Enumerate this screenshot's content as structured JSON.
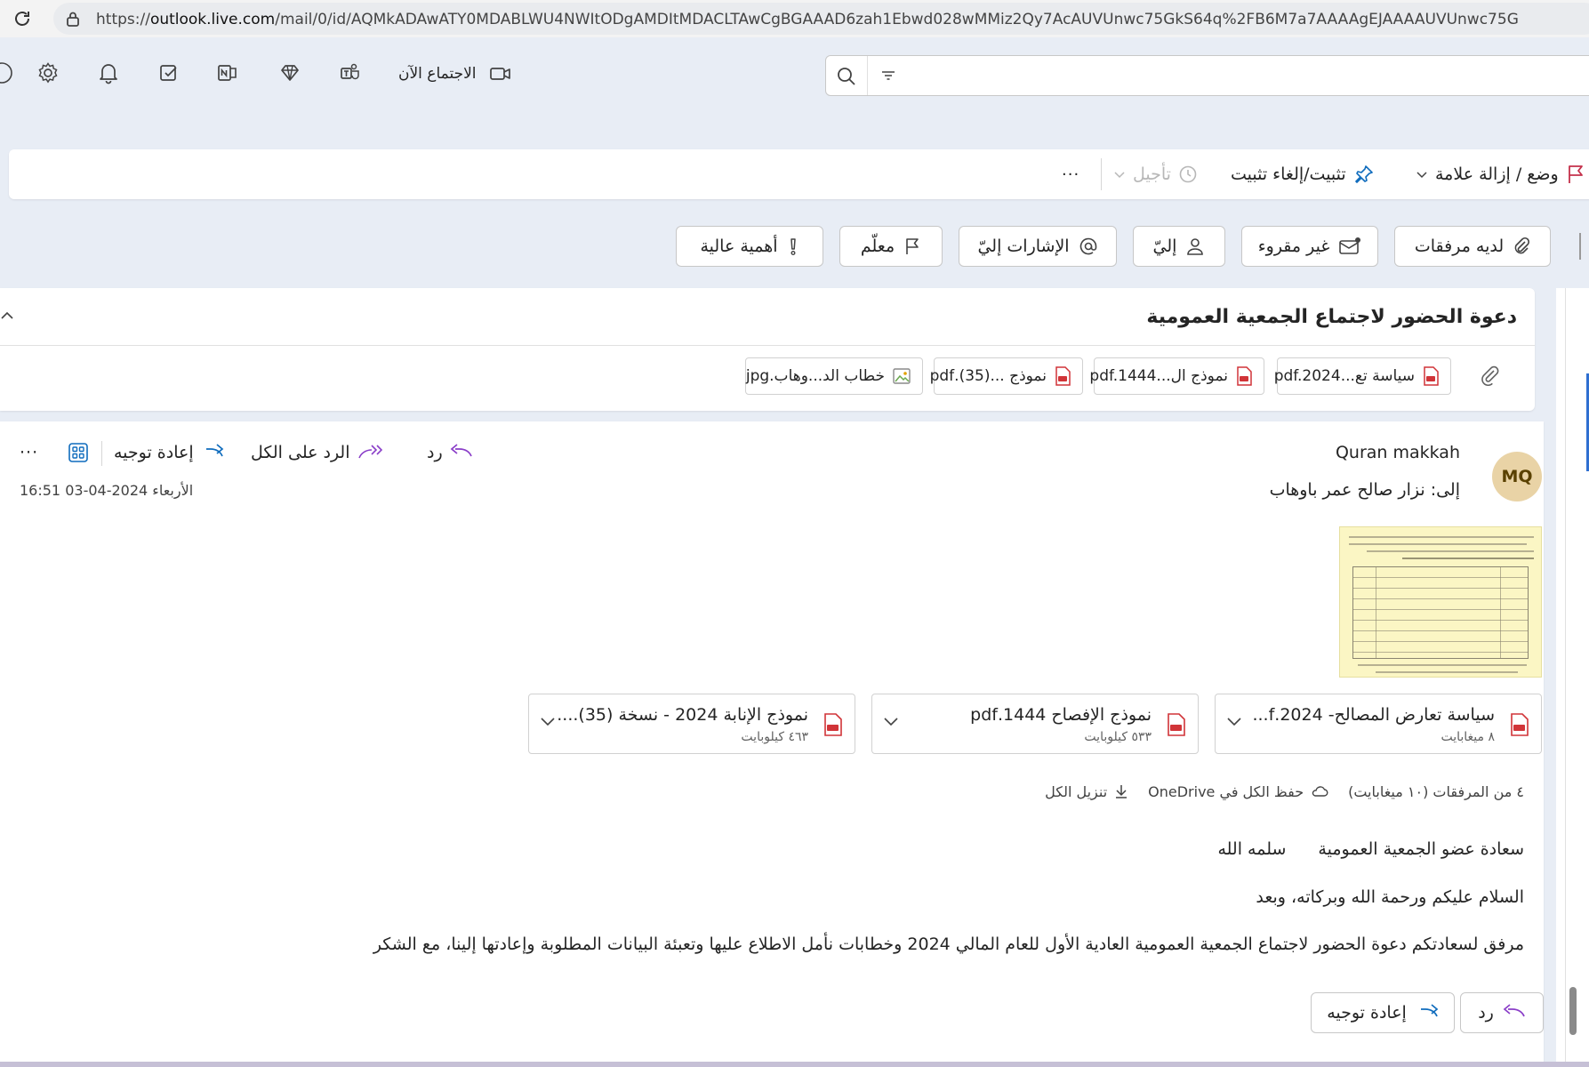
{
  "browser": {
    "url_prefix": "https://",
    "url_domain": "outlook.live.com",
    "url_path": "/mail/0/id/AQMkADAwATY0MDABLWU4NWItODgAMDItMDACLTAwCgBGAAAD6zah1Ebwd028wMMiz2Qy7AcAUVUnwc75GkS64q%2FB6M7a7AAAAgEJAAAAUVUnwc75G"
  },
  "header": {
    "meet_now_label": "الاجتماع الآن",
    "icons": [
      "settings-icon",
      "bell-icon",
      "note-check-icon",
      "onenote-icon",
      "premium-diamond-icon",
      "teams-icon",
      "video-camera-icon"
    ]
  },
  "search": {
    "placeholder": ""
  },
  "toolbar": {
    "flag_label": "وضع / إزالة علامة",
    "pin_label": "تثبيت/إلغاء تثبيت",
    "snooze_label": "تأجيل",
    "more_label": "···"
  },
  "filters": {
    "attachments": "لديه مرفقات",
    "unread": "غير مقروء",
    "to_me": "إليّ",
    "mentions": "الإشارات إليّ",
    "flagged": "معلّم",
    "high_importance": "أهمية عالية"
  },
  "subject": {
    "title": "دعوة الحضور لاجتماع الجمعية العمومية",
    "attachments": [
      {
        "name": "سياسة تع...pdf.2024",
        "type": "pdf"
      },
      {
        "name": "نموذج ال...pdf.1444",
        "type": "pdf"
      },
      {
        "name": "نموذج ...(35).pdf",
        "type": "pdf"
      },
      {
        "name": "خطاب الد...وهاب.jpg",
        "type": "image"
      }
    ]
  },
  "message": {
    "avatar_initials": "MQ",
    "sender": "Quran makkah",
    "to_prefix": "إلى:",
    "recipient": "نزار صالح عمر باوهاب",
    "date": "الأربعاء 2024-04-03 16:51",
    "actions": {
      "reply": "رد",
      "reply_all": "الرد على الكل",
      "forward": "إعادة توجيه",
      "more": "···"
    },
    "files": [
      {
        "name": "سياسة تعارض المصالح- 2024.f...",
        "size": "٨ ميغابايت"
      },
      {
        "name": "نموذج الإفصاح 1444.pdf",
        "size": "٥٣٣ كيلوبايت"
      },
      {
        "name": "نموذج الإنابة 2024 - نسخة (35)....",
        "size": "٤٦٣ كيلوبايت"
      }
    ],
    "attachments_summary": "٤ من المرفقات (١٠ ميغابايت)",
    "save_onedrive": "حفظ الكل في OneDrive",
    "download_all": "تنزيل الكل",
    "body": {
      "greeting_a": "سعادة عضو الجمعية العمومية",
      "greeting_b": "سلمه الله",
      "salam": "السلام عليكم ورحمة الله وبركاته، وبعد",
      "main": "مرفق لسعادتكم دعوة الحضور لاجتماع الجمعية العمومية العادية الأول للعام المالي 2024 وخطابات نأمل الاطلاع عليها وتعبئة البيانات المطلوبة وإعادتها إلينا، مع الشكر"
    },
    "bottom_buttons": {
      "reply": "رد",
      "forward": "إعادة توجيه"
    }
  },
  "colors": {
    "accent_purple": "#8a3ec8",
    "flag_red": "#c4314b",
    "pin_blue": "#0f6cbd",
    "pdf_red": "#d13438",
    "image_green": "#6aa84f",
    "avatar_bg": "#e9d3a6"
  }
}
